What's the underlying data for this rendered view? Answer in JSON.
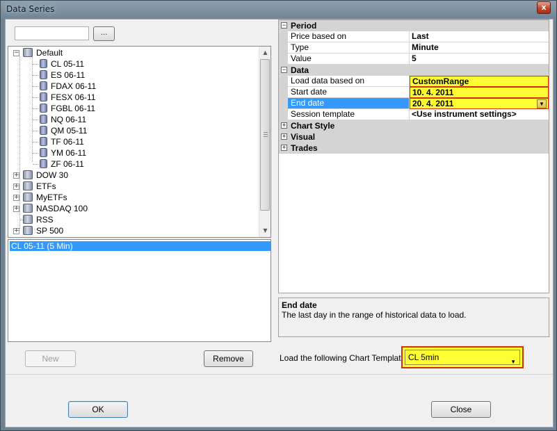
{
  "window": {
    "title": "Data Series",
    "close_glyph": "x"
  },
  "search": {
    "value": "",
    "browse_label": "..."
  },
  "tree": {
    "default_group": "Default",
    "default_items": [
      "CL 05-11",
      "ES 06-11",
      "FDAX 06-11",
      "FESX 06-11",
      "FGBL 06-11",
      "NQ 06-11",
      "QM 05-11",
      "TF 06-11",
      "YM 06-11",
      "ZF 06-11"
    ],
    "groups": [
      "DOW 30",
      "ETFs",
      "MyETFs",
      "NASDAQ 100",
      "RSS",
      "SP 500"
    ]
  },
  "series_list": {
    "items": [
      "CL 05-11 (5 Min)"
    ]
  },
  "buttons": {
    "new": "New",
    "remove": "Remove",
    "ok": "OK",
    "close": "Close"
  },
  "properties": {
    "period": {
      "label": "Period",
      "price_based_on": {
        "name": "Price based on",
        "value": "Last"
      },
      "type": {
        "name": "Type",
        "value": "Minute"
      },
      "value": {
        "name": "Value",
        "value": "5"
      }
    },
    "data": {
      "label": "Data",
      "load_data": {
        "name": "Load data based on",
        "value": "CustomRange"
      },
      "start_date": {
        "name": "Start date",
        "value": "10. 4. 2011"
      },
      "end_date": {
        "name": "End date",
        "value": "20. 4. 2011"
      },
      "session_template": {
        "name": "Session template",
        "value": "<Use instrument settings>"
      }
    },
    "chart_style": {
      "label": "Chart Style"
    },
    "visual": {
      "label": "Visual"
    },
    "trades": {
      "label": "Trades"
    }
  },
  "description": {
    "title": "End date",
    "text": "The last day in the range of historical data to load."
  },
  "template": {
    "label": "Load the following Chart Template:",
    "value": "CL 5min"
  },
  "colors": {
    "highlight": "#ffff33",
    "highlight_border": "#cc3300",
    "selection": "#3399ff"
  }
}
